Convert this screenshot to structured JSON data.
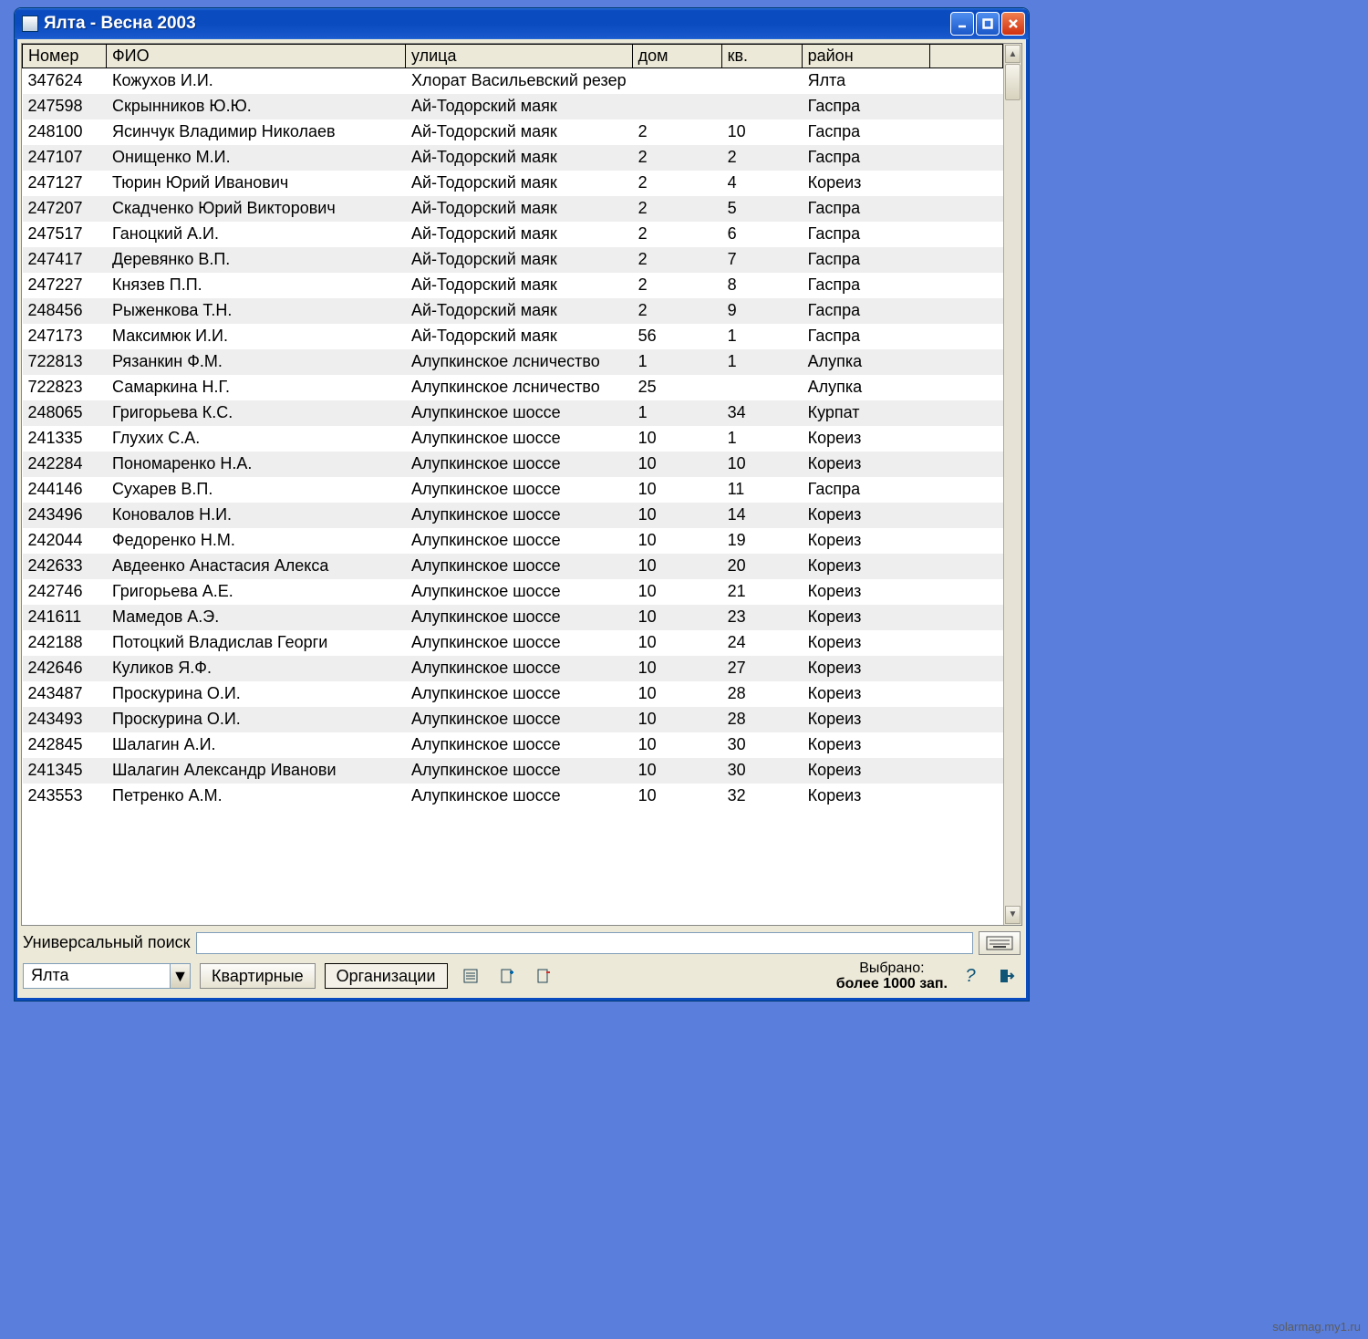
{
  "window": {
    "title": "Ялта  - Весна 2003"
  },
  "columns": {
    "number": "Номер",
    "fio": "ФИО",
    "street": "улица",
    "house": "дом",
    "apt": "кв.",
    "district": "район"
  },
  "rows": [
    {
      "num": "347624",
      "fio": "Кожухов И.И.",
      "street": " Хлорат Васильевский резер",
      "house": "",
      "apt": "",
      "dist": "Ялта"
    },
    {
      "num": "247598",
      "fio": "Скрынников Ю.Ю.",
      "street": "Ай-Тодорский маяк",
      "house": "",
      "apt": "",
      "dist": "Гаспра"
    },
    {
      "num": "248100",
      "fio": "Ясинчук Владимир Николаев",
      "street": "Ай-Тодорский маяк",
      "house": "2",
      "apt": "10",
      "dist": "Гаспра"
    },
    {
      "num": "247107",
      "fio": "Онищенко М.И.",
      "street": "Ай-Тодорский маяк",
      "house": "2",
      "apt": "2",
      "dist": "Гаспра"
    },
    {
      "num": "247127",
      "fio": "Тюрин Юрий Иванович",
      "street": "Ай-Тодорский маяк",
      "house": "2",
      "apt": "4",
      "dist": "Кореиз"
    },
    {
      "num": "247207",
      "fio": "Скадченко Юрий Викторович",
      "street": "Ай-Тодорский маяк",
      "house": "2",
      "apt": "5",
      "dist": "Гаспра"
    },
    {
      "num": "247517",
      "fio": "Ганоцкий А.И.",
      "street": "Ай-Тодорский маяк",
      "house": "2",
      "apt": "6",
      "dist": "Гаспра"
    },
    {
      "num": "247417",
      "fio": "Деревянко В.П.",
      "street": "Ай-Тодорский маяк",
      "house": "2",
      "apt": "7",
      "dist": "Гаспра"
    },
    {
      "num": "247227",
      "fio": "Князев П.П.",
      "street": "Ай-Тодорский маяк",
      "house": "2",
      "apt": "8",
      "dist": "Гаспра"
    },
    {
      "num": "248456",
      "fio": "Рыженкова Т.Н.",
      "street": "Ай-Тодорский маяк",
      "house": "2",
      "apt": "9",
      "dist": "Гаспра"
    },
    {
      "num": "247173",
      "fio": "Максимюк И.И.",
      "street": "Ай-Тодорский маяк",
      "house": "56",
      "apt": "1",
      "dist": "Гаспра"
    },
    {
      "num": "722813",
      "fio": "Рязанкин Ф.М.",
      "street": "Алупкинское лсничество",
      "house": "1",
      "apt": "1",
      "dist": "Алупка"
    },
    {
      "num": "722823",
      "fio": "Самаркина Н.Г.",
      "street": "Алупкинское лсничество",
      "house": "25",
      "apt": "",
      "dist": "Алупка"
    },
    {
      "num": "248065",
      "fio": "Григорьева К.С.",
      "street": "Алупкинское шоссе",
      "house": "1",
      "apt": "34",
      "dist": "Курпат"
    },
    {
      "num": "241335",
      "fio": "Глухих С.А.",
      "street": "Алупкинское шоссе",
      "house": "10",
      "apt": "1",
      "dist": "Кореиз"
    },
    {
      "num": "242284",
      "fio": "Пономаренко Н.А.",
      "street": "Алупкинское шоссе",
      "house": "10",
      "apt": "10",
      "dist": "Кореиз"
    },
    {
      "num": "244146",
      "fio": "Сухарев В.П.",
      "street": "Алупкинское шоссе",
      "house": "10",
      "apt": "11",
      "dist": "Гаспра"
    },
    {
      "num": "243496",
      "fio": "Коновалов Н.И.",
      "street": "Алупкинское шоссе",
      "house": "10",
      "apt": "14",
      "dist": "Кореиз"
    },
    {
      "num": "242044",
      "fio": "Федоренко Н.М.",
      "street": "Алупкинское шоссе",
      "house": "10",
      "apt": "19",
      "dist": "Кореиз"
    },
    {
      "num": "242633",
      "fio": "Авдеенко Анастасия Алекса",
      "street": "Алупкинское шоссе",
      "house": "10",
      "apt": "20",
      "dist": "Кореиз"
    },
    {
      "num": "242746",
      "fio": "Григорьева А.Е.",
      "street": "Алупкинское шоссе",
      "house": "10",
      "apt": "21",
      "dist": "Кореиз"
    },
    {
      "num": "241611",
      "fio": "Мамедов А.Э.",
      "street": "Алупкинское шоссе",
      "house": "10",
      "apt": "23",
      "dist": "Кореиз"
    },
    {
      "num": "242188",
      "fio": "Потоцкий Владислав Георги",
      "street": "Алупкинское шоссе",
      "house": "10",
      "apt": "24",
      "dist": "Кореиз"
    },
    {
      "num": "242646",
      "fio": "Куликов Я.Ф.",
      "street": "Алупкинское шоссе",
      "house": "10",
      "apt": "27",
      "dist": "Кореиз"
    },
    {
      "num": "243487",
      "fio": "Проскурина О.И.",
      "street": "Алупкинское шоссе",
      "house": "10",
      "apt": "28",
      "dist": "Кореиз"
    },
    {
      "num": "243493",
      "fio": "Проскурина О.И.",
      "street": "Алупкинское шоссе",
      "house": "10",
      "apt": "28",
      "dist": "Кореиз"
    },
    {
      "num": "242845",
      "fio": "Шалагин А.И.",
      "street": "Алупкинское шоссе",
      "house": "10",
      "apt": "30",
      "dist": "Кореиз"
    },
    {
      "num": "241345",
      "fio": "Шалагин Александр Иванови",
      "street": "Алупкинское шоссе",
      "house": "10",
      "apt": "30",
      "dist": "Кореиз"
    },
    {
      "num": "243553",
      "fio": "Петренко А.М.",
      "street": "Алупкинское шоссе",
      "house": "10",
      "apt": "32",
      "dist": "Кореиз"
    }
  ],
  "search": {
    "label": "Универсальный поиск",
    "value": ""
  },
  "footer": {
    "city_combo": "Ялта",
    "btn_apartments": "Квартирные",
    "btn_orgs": "Организации",
    "selected_label": "Выбрано:",
    "selected_value": "более 1000 зап."
  },
  "watermark": "solarmag.my1.ru"
}
